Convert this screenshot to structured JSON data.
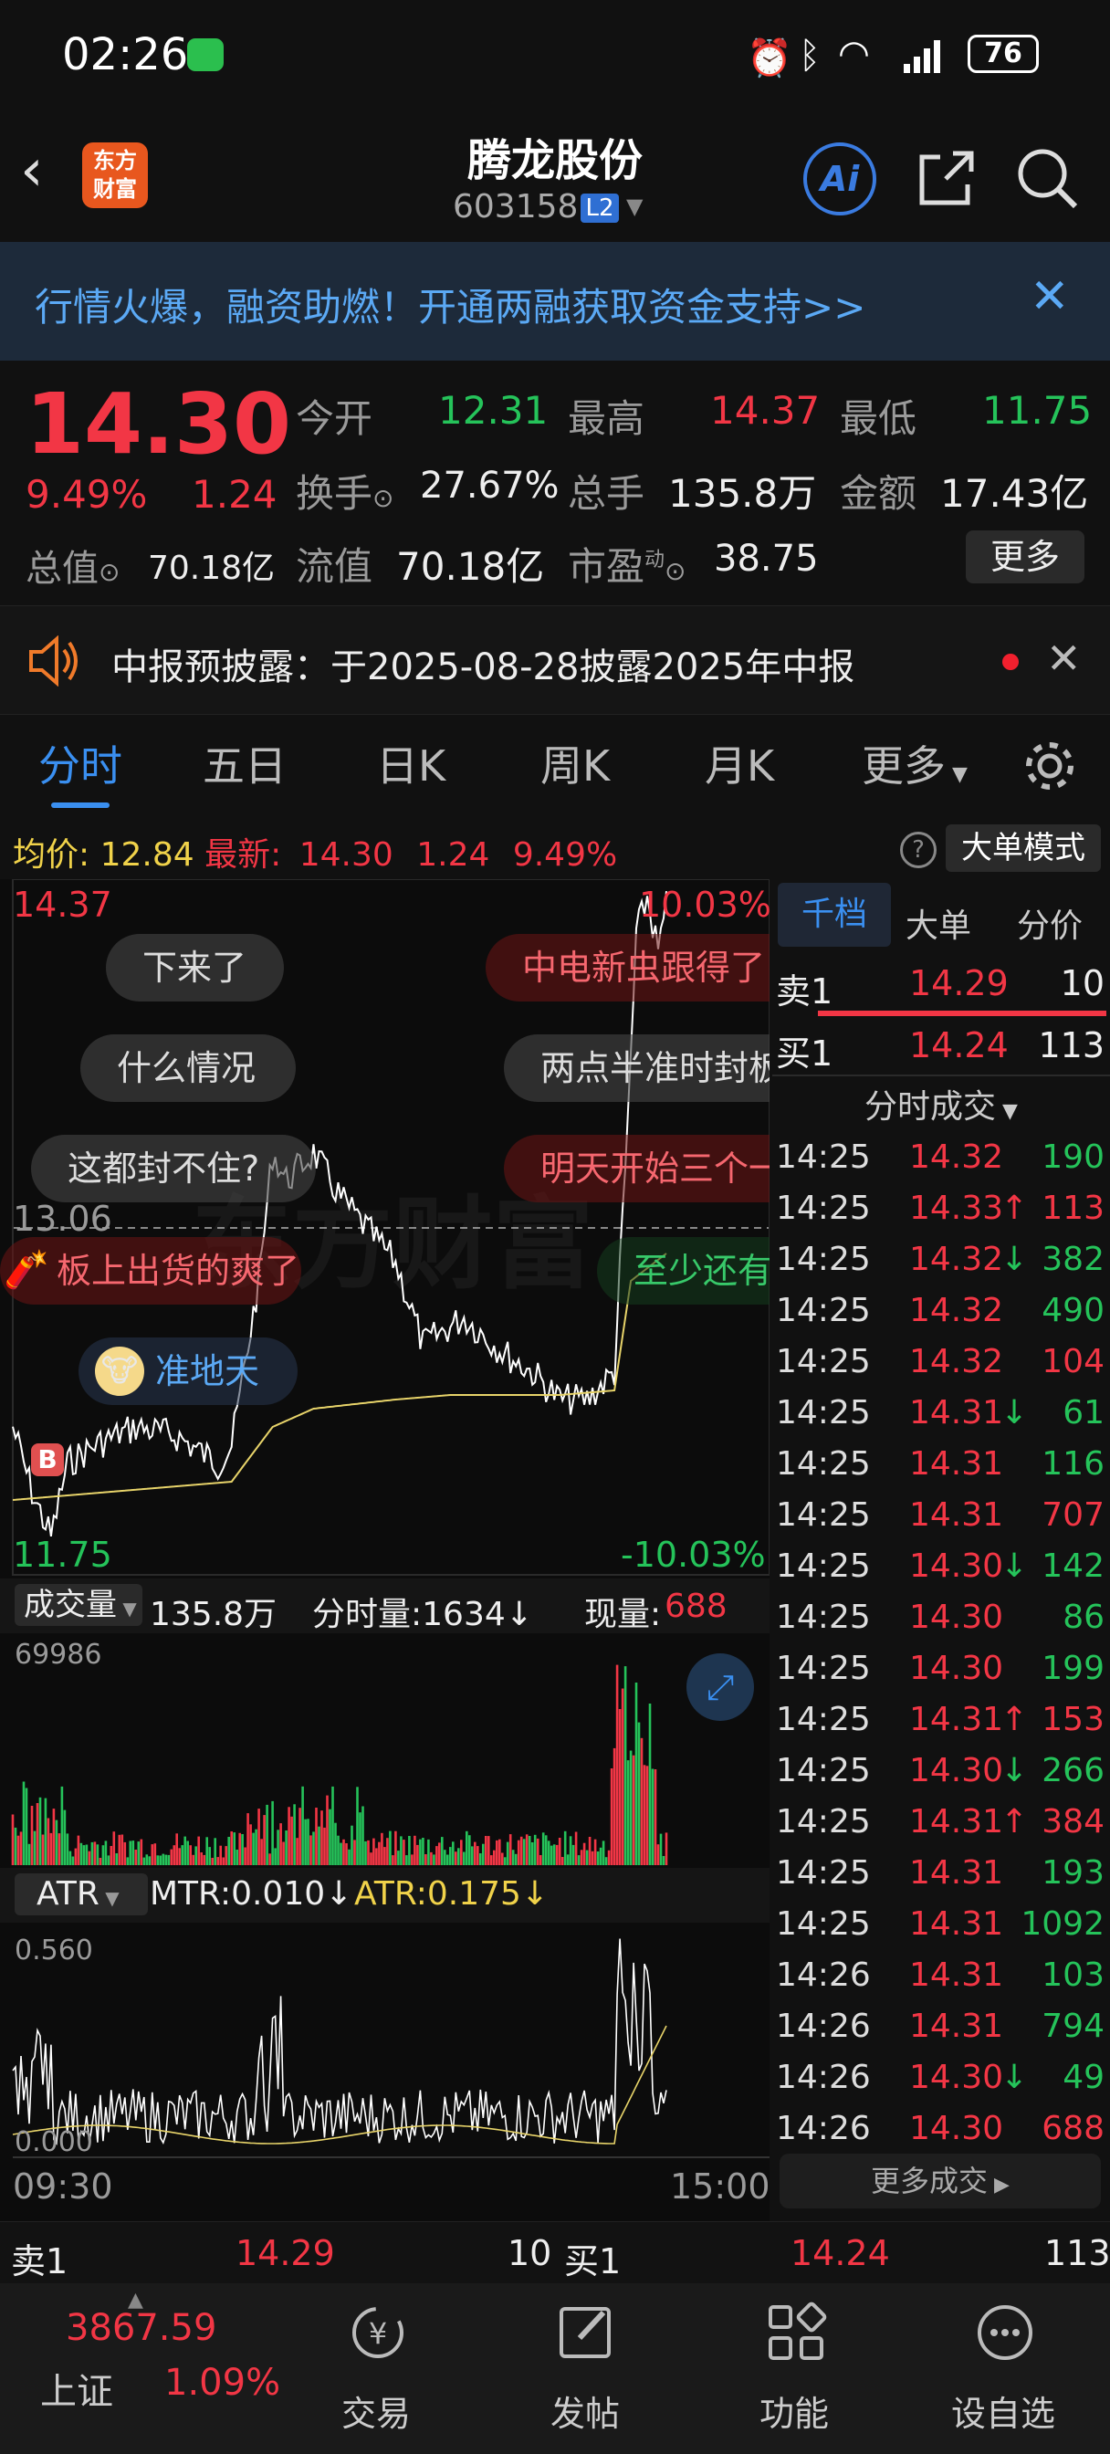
{
  "status": {
    "time": "02:26",
    "battery": "76"
  },
  "nav": {
    "title": "腾龙股份",
    "code": "603158",
    "level": "L2",
    "logo_line1": "东方",
    "logo_line2": "财富"
  },
  "banner": {
    "text": "行情火爆，融资助燃！开通两融获取资金支持>>"
  },
  "quote": {
    "price": "14.30",
    "pct": "9.49%",
    "chg": "1.24",
    "open_label": "今开",
    "open": "12.31",
    "high_label": "最高",
    "high": "14.37",
    "low_label": "最低",
    "low": "11.75",
    "turnover_label": "换手",
    "turnover": "27.67%",
    "volume_label": "总手",
    "volume": "135.8万",
    "amount_label": "金额",
    "amount": "17.43亿",
    "mcap_label": "总值",
    "mcap": "70.18亿",
    "float_label": "流值",
    "float": "70.18亿",
    "pe_label": "市盈",
    "pe_sup": "动",
    "pe": "38.75",
    "more_label": "更多"
  },
  "notice": {
    "text": "中报预披露：于2025-08-28披露2025年中报"
  },
  "tabs": [
    {
      "label": "分时"
    },
    {
      "label": "五日"
    },
    {
      "label": "日K"
    },
    {
      "label": "周K"
    },
    {
      "label": "月K"
    },
    {
      "label": "更多"
    }
  ],
  "info": {
    "avg_label": "均价:",
    "avg": "12.84",
    "last_label": "最新:",
    "last": "14.30",
    "chg": "1.24",
    "pct": "9.49%",
    "mode_label": "大单模式"
  },
  "chart": {
    "price_high": "14.37",
    "price_mid": "13.06",
    "price_low": "11.75",
    "pct_high": "10.03%",
    "pct_low": "-10.03%",
    "vol_label": "成交量",
    "vol_total": "135.8万",
    "vol_min_label": "分时量:1634↓",
    "vol_now_label": "现量:",
    "vol_now": "688",
    "vol_max": "69986",
    "atr_label": "ATR",
    "mtr": "MTR:0.010↓",
    "atr": "ATR:0.175↓",
    "atr_max": "0.560",
    "atr_min": "0.000",
    "time_start": "09:30",
    "time_end": "15:00",
    "marker_b": "B"
  },
  "bubbles": [
    {
      "text": "下来了"
    },
    {
      "text": "什么情况"
    },
    {
      "text": "这都封不住?"
    },
    {
      "text": "板上出货的爽了"
    },
    {
      "text": "准地天"
    },
    {
      "text": "中电新虫跟得了"
    },
    {
      "text": "两点半准时封板"
    },
    {
      "text": "明天开始三个一"
    },
    {
      "text": "至少还有"
    }
  ],
  "watermark": "东方财富",
  "panel": {
    "tabs": [
      {
        "label": "千档"
      },
      {
        "label": "大单"
      },
      {
        "label": "分价"
      }
    ],
    "sell1_label": "卖1",
    "sell1_price": "14.29",
    "sell1_vol": "10",
    "buy1_label": "买1",
    "buy1_price": "14.24",
    "buy1_vol": "113",
    "trades_header": "分时成交",
    "more_trades": "更多成交"
  },
  "trades": [
    {
      "time": "14:25",
      "price": "14.32",
      "arrow": "",
      "vol": "190",
      "vc": "green"
    },
    {
      "time": "14:25",
      "price": "14.33",
      "arrow": "↑",
      "vol": "113",
      "vc": "red"
    },
    {
      "time": "14:25",
      "price": "14.32",
      "arrow": "↓",
      "vol": "382",
      "vc": "green"
    },
    {
      "time": "14:25",
      "price": "14.32",
      "arrow": "",
      "vol": "490",
      "vc": "green"
    },
    {
      "time": "14:25",
      "price": "14.32",
      "arrow": "",
      "vol": "104",
      "vc": "red"
    },
    {
      "time": "14:25",
      "price": "14.31",
      "arrow": "↓",
      "vol": "61",
      "vc": "green"
    },
    {
      "time": "14:25",
      "price": "14.31",
      "arrow": "",
      "vol": "116",
      "vc": "green"
    },
    {
      "time": "14:25",
      "price": "14.31",
      "arrow": "",
      "vol": "707",
      "vc": "red"
    },
    {
      "time": "14:25",
      "price": "14.30",
      "arrow": "↓",
      "vol": "142",
      "vc": "green"
    },
    {
      "time": "14:25",
      "price": "14.30",
      "arrow": "",
      "vol": "86",
      "vc": "green"
    },
    {
      "time": "14:25",
      "price": "14.30",
      "arrow": "",
      "vol": "199",
      "vc": "green"
    },
    {
      "time": "14:25",
      "price": "14.31",
      "arrow": "↑",
      "vol": "153",
      "vc": "red"
    },
    {
      "time": "14:25",
      "price": "14.30",
      "arrow": "↓",
      "vol": "266",
      "vc": "green"
    },
    {
      "time": "14:25",
      "price": "14.31",
      "arrow": "↑",
      "vol": "384",
      "vc": "red"
    },
    {
      "time": "14:25",
      "price": "14.31",
      "arrow": "",
      "vol": "193",
      "vc": "green"
    },
    {
      "time": "14:25",
      "price": "14.31",
      "arrow": "",
      "vol": "1092",
      "vc": "green"
    },
    {
      "time": "14:26",
      "price": "14.31",
      "arrow": "",
      "vol": "103",
      "vc": "green"
    },
    {
      "time": "14:26",
      "price": "14.31",
      "arrow": "",
      "vol": "794",
      "vc": "green"
    },
    {
      "time": "14:26",
      "price": "14.30",
      "arrow": "↓",
      "vol": "49",
      "vc": "green"
    },
    {
      "time": "14:26",
      "price": "14.30",
      "arrow": "",
      "vol": "688",
      "vc": "red"
    }
  ],
  "bottom": {
    "sell1_label": "卖1",
    "sell1_price": "14.29",
    "sell1_vol": "10",
    "buy1_label": "买1",
    "buy1_price": "14.24",
    "buy1_vol": "113"
  },
  "bottomnav": {
    "index_value": "3867.59",
    "index_name": "上证",
    "index_pct": "1.09%",
    "items": [
      {
        "label": "交易"
      },
      {
        "label": "发帖"
      },
      {
        "label": "功能"
      },
      {
        "label": "设自选"
      }
    ]
  },
  "colors": {
    "up": "#f23645",
    "down": "#25c35a",
    "avg_line": "#e8d46a",
    "price_line": "#ffffff"
  }
}
